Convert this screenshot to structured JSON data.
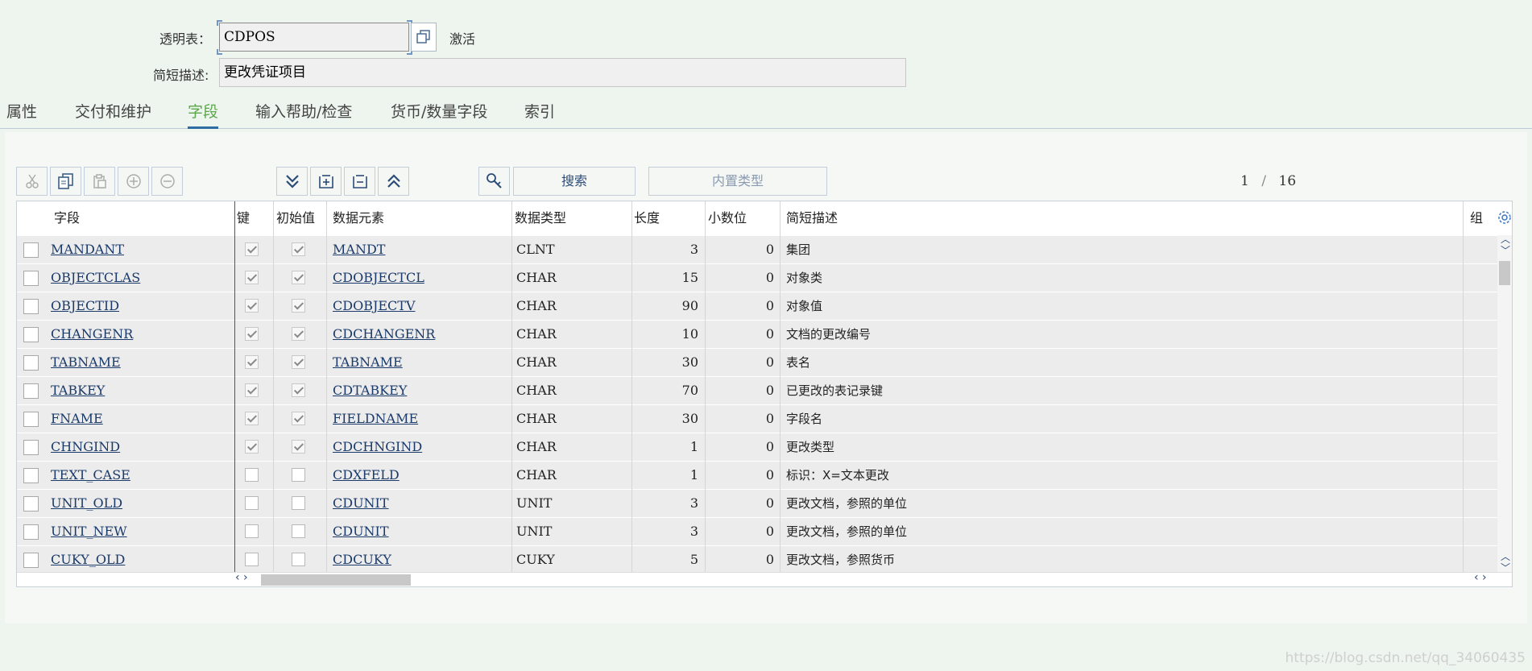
{
  "header": {
    "table_label": "透明表：",
    "table_value": "CDPOS",
    "status": "激活",
    "desc_label": "简短描述:",
    "desc_value": "更改凭证项目"
  },
  "tabs": [
    {
      "label": "属性"
    },
    {
      "label": "交付和维护"
    },
    {
      "label": "字段",
      "active": true
    },
    {
      "label": "输入帮助/检查"
    },
    {
      "label": "货币/数量字段"
    },
    {
      "label": "索引"
    }
  ],
  "toolbar": {
    "search_label": "搜索",
    "builtin_type_label": "内置类型",
    "page_current": "1",
    "page_separator": "/",
    "page_total": "16"
  },
  "icons": [
    "cut-icon",
    "copy-icon",
    "paste-icon",
    "insert-row-icon",
    "delete-row-icon",
    "expand-all-icon",
    "expand-icon",
    "collapse-icon",
    "collapse-all-icon",
    "key-icon",
    "settings-icon"
  ],
  "colors": {
    "active_tab": "#5aa84a",
    "tab_underline": "#2e6ca4",
    "link": "#1a3a6a"
  },
  "table": {
    "columns": [
      "字段",
      "键",
      "初始值",
      "数据元素",
      "数据类型",
      "长度",
      "小数位",
      "简短描述",
      "组"
    ],
    "rows": [
      {
        "field": "MANDANT",
        "key": true,
        "init": true,
        "element": "MANDT",
        "type": "CLNT",
        "length": "3",
        "decimals": "0",
        "desc": "集团"
      },
      {
        "field": "OBJECTCLAS",
        "key": true,
        "init": true,
        "element": "CDOBJECTCL",
        "type": "CHAR",
        "length": "15",
        "decimals": "0",
        "desc": "对象类"
      },
      {
        "field": "OBJECTID",
        "key": true,
        "init": true,
        "element": "CDOBJECTV",
        "type": "CHAR",
        "length": "90",
        "decimals": "0",
        "desc": "对象值"
      },
      {
        "field": "CHANGENR",
        "key": true,
        "init": true,
        "element": "CDCHANGENR",
        "type": "CHAR",
        "length": "10",
        "decimals": "0",
        "desc": "文档的更改编号"
      },
      {
        "field": "TABNAME",
        "key": true,
        "init": true,
        "element": "TABNAME",
        "type": "CHAR",
        "length": "30",
        "decimals": "0",
        "desc": "表名"
      },
      {
        "field": "TABKEY",
        "key": true,
        "init": true,
        "element": "CDTABKEY",
        "type": "CHAR",
        "length": "70",
        "decimals": "0",
        "desc": "已更改的表记录键"
      },
      {
        "field": "FNAME",
        "key": true,
        "init": true,
        "element": "FIELDNAME",
        "type": "CHAR",
        "length": "30",
        "decimals": "0",
        "desc": "字段名"
      },
      {
        "field": "CHNGIND",
        "key": true,
        "init": true,
        "element": "CDCHNGIND",
        "type": "CHAR",
        "length": "1",
        "decimals": "0",
        "desc": "更改类型"
      },
      {
        "field": "TEXT_CASE",
        "key": false,
        "init": false,
        "element": "CDXFELD",
        "type": "CHAR",
        "length": "1",
        "decimals": "0",
        "desc": "标识：X=文本更改"
      },
      {
        "field": "UNIT_OLD",
        "key": false,
        "init": false,
        "element": "CDUNIT",
        "type": "UNIT",
        "length": "3",
        "decimals": "0",
        "desc": "更改文档，参照的单位"
      },
      {
        "field": "UNIT_NEW",
        "key": false,
        "init": false,
        "element": "CDUNIT",
        "type": "UNIT",
        "length": "3",
        "decimals": "0",
        "desc": "更改文档，参照的单位"
      },
      {
        "field": "CUKY_OLD",
        "key": false,
        "init": false,
        "element": "CDCUKY",
        "type": "CUKY",
        "length": "5",
        "decimals": "0",
        "desc": "更改文档，参照货币"
      }
    ]
  },
  "watermark": "https://blog.csdn.net/qq_34060435"
}
